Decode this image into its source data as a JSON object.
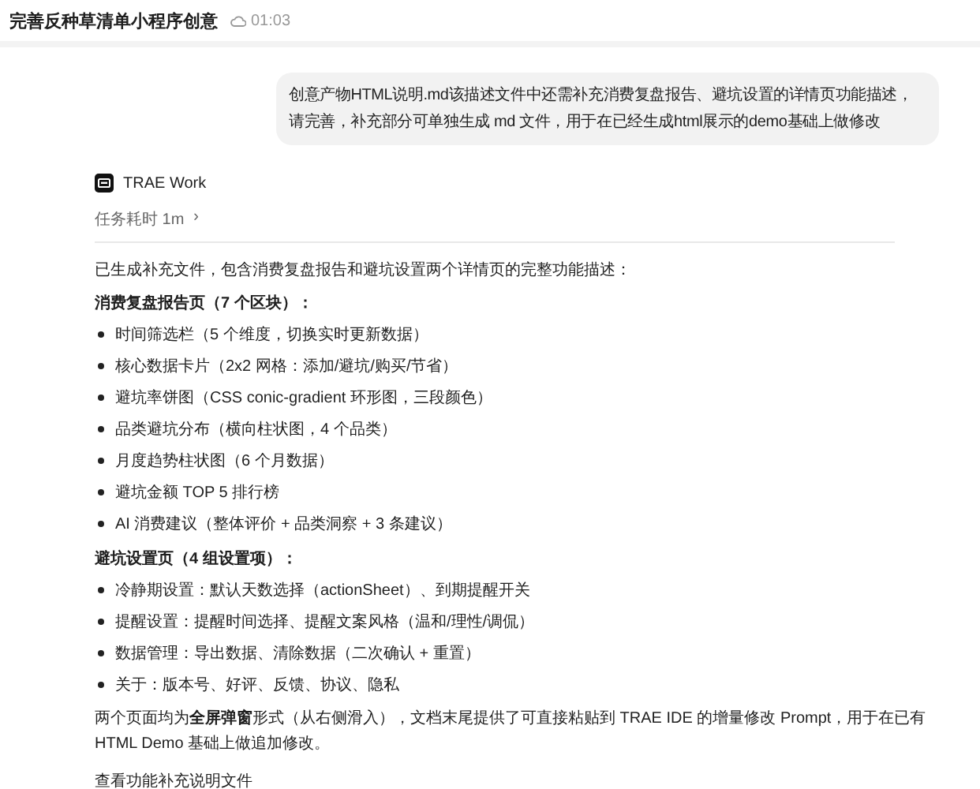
{
  "header": {
    "title": "完善反种草清单小程序创意",
    "time": "01:03"
  },
  "user_message": "创意产物HTML说明.md该描述文件中还需补充消费复盘报告、避坑设置的详情页功能描述，请完善，补充部分可单独生成 md 文件，用于在已经生成html展示的demo基础上做修改",
  "agent": {
    "name": "TRAE Work",
    "duration": "任务耗时 1m",
    "duration_arrow": "›"
  },
  "response": {
    "intro": "已生成补充文件，包含消费复盘报告和避坑设置两个详情页的完整功能描述：",
    "sections": [
      {
        "heading": "消费复盘报告页（7 个区块）：",
        "items": [
          "时间筛选栏（5 个维度，切换实时更新数据）",
          "核心数据卡片（2x2 网格：添加/避坑/购买/节省）",
          "避坑率饼图（CSS conic-gradient 环形图，三段颜色）",
          "品类避坑分布（横向柱状图，4 个品类）",
          "月度趋势柱状图（6 个月数据）",
          "避坑金额 TOP 5 排行榜",
          "AI 消费建议（整体评价 + 品类洞察 + 3 条建议）"
        ]
      },
      {
        "heading": "避坑设置页（4 组设置项）：",
        "items": [
          "冷静期设置：默认天数选择（actionSheet）、到期提醒开关",
          "提醒设置：提醒时间选择、提醒文案风格（温和/理性/调侃）",
          "数据管理：导出数据、清除数据（二次确认 + 重置）",
          "关于：版本号、好评、反馈、协议、隐私"
        ]
      }
    ],
    "summary": "两个页面均为**全屏弹窗**形式（从右侧滑入），文档末尾提供了可直接粘贴到 TRAE IDE 的增量修改 Prompt，用于在已有 HTML Demo 基础上做追加修改。",
    "link": "查看功能补充说明文件"
  }
}
